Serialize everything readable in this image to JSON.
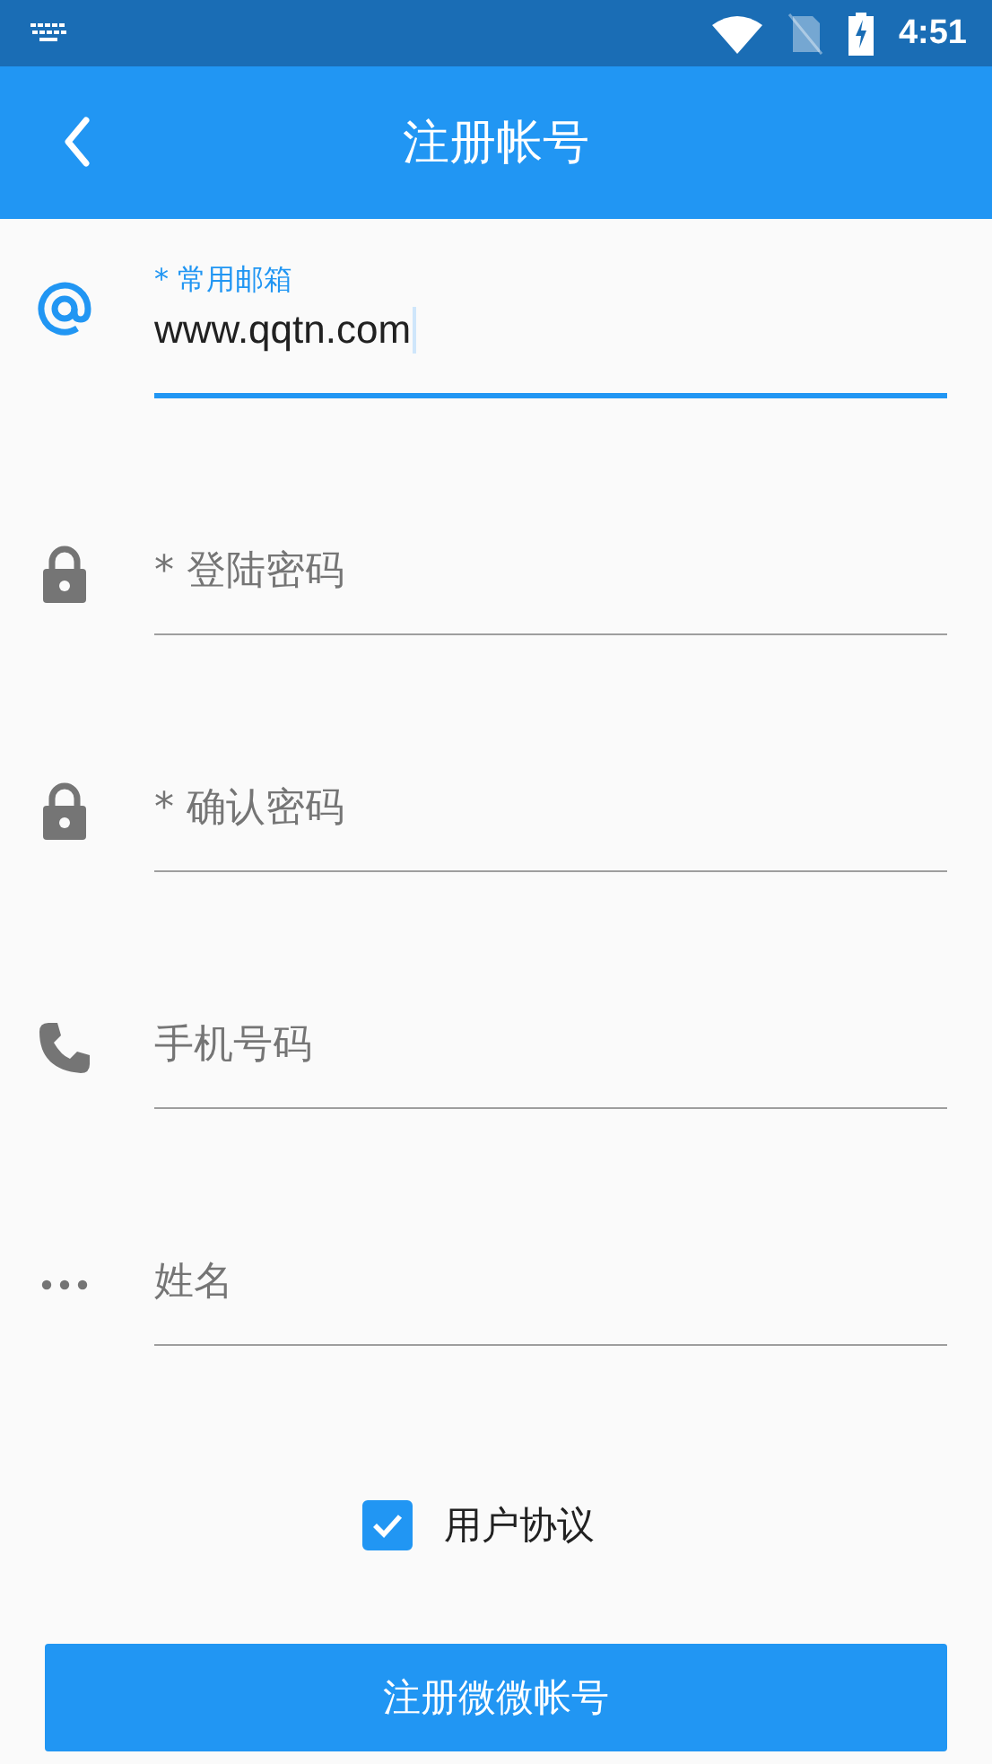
{
  "status_bar": {
    "time": "4:51"
  },
  "app_bar": {
    "title": "注册帐号"
  },
  "fields": [
    {
      "kind": "email",
      "label": "* 常用邮箱",
      "value": "www.qqtn.com",
      "focused": true
    },
    {
      "kind": "password",
      "placeholder": "* 登陆密码",
      "focused": false
    },
    {
      "kind": "password",
      "placeholder": "* 确认密码",
      "focused": false
    },
    {
      "kind": "phone",
      "placeholder": "手机号码",
      "focused": false
    },
    {
      "kind": "more",
      "placeholder": "姓名",
      "focused": false
    }
  ],
  "agreement": {
    "label": "用户协议",
    "checked": true
  },
  "submit_button": {
    "label": "注册微微帐号"
  }
}
